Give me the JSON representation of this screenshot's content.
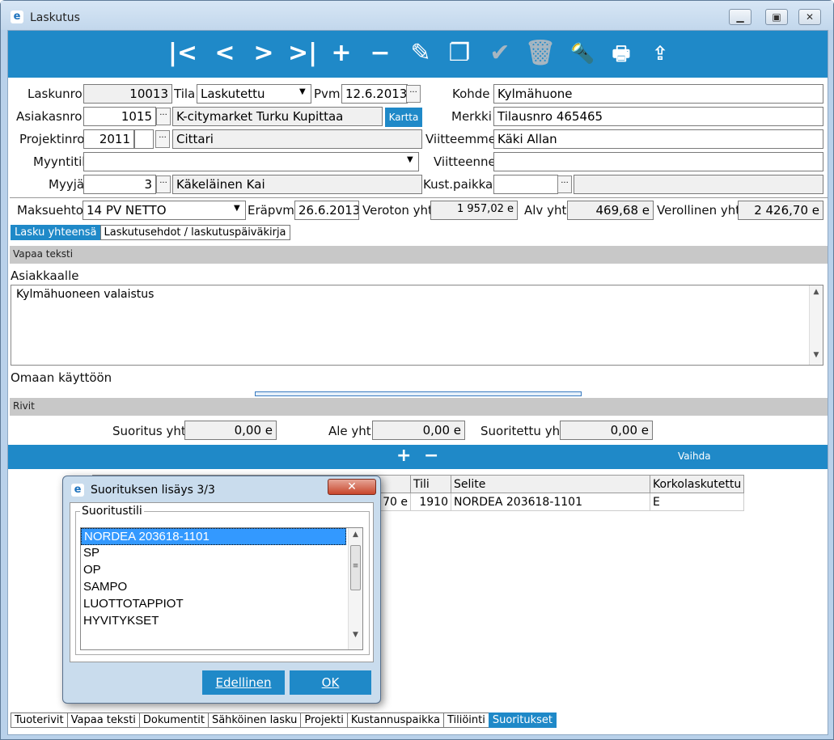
{
  "window": {
    "title": "Laskutus",
    "app_icon": "e"
  },
  "toolbar": {
    "icons": [
      "first-icon",
      "prev-icon",
      "next-icon",
      "last-icon",
      "add-icon",
      "remove-icon",
      "edit-icon",
      "copy-icon",
      "confirm-icon",
      "delete-icon",
      "search-icon",
      "print-icon",
      "export-icon"
    ]
  },
  "header": {
    "laskunro_label": "Laskunro",
    "laskunro": "10013",
    "tila_label": "Tila",
    "tila": "Laskutettu",
    "pvm_label": "Pvm",
    "pvm": "12.6.2013",
    "kohde_label": "Kohde",
    "kohde": "Kylmähuone",
    "asiakasnro_label": "Asiakasnro",
    "asiakasnro": "1015",
    "asiakas_nimi": "K-citymarket Turku Kupittaa",
    "kartta": "Kartta",
    "merkki_label": "Merkki",
    "merkki": "Tilausnro 465465",
    "projektinro_label": "Projektinro",
    "projektinro": "2011",
    "projekti_nimi": "Cittari",
    "viitteemme_label": "Viitteemme",
    "viitteemme": "Käki Allan",
    "myyntitili_label": "Myyntitili",
    "myyntitili": "",
    "viitteenne_label": "Viitteenne",
    "viitteenne": "",
    "myyja_label": "Myyjä",
    "myyja": "3",
    "myyja_nimi": "Käkeläinen Kai",
    "kustpaikka_label": "Kust.paikka",
    "kustpaikka": "",
    "maksuehto_label": "Maksuehto",
    "maksuehto": "14 PV NETTO",
    "erapvm_label": "Eräpvm",
    "erapvm": "26.6.2013",
    "veroton_label": "Veroton yht.",
    "veroton": "1 957,02 e",
    "alv_label": "Alv yht.",
    "alv": "469,68 e",
    "verollinen_label": "Verollinen yht.",
    "verollinen": "2 426,70 e"
  },
  "top_tabs": [
    "Lasku yhteensä",
    "Laskutusehdot / laskutuspäiväkirja"
  ],
  "vapaa": {
    "section": "Vapaa teksti",
    "asiakkaalle_label": "Asiakkaalle",
    "asiakkaalle_text": "Kylmähuoneen valaistus",
    "omaan_label": "Omaan käyttöön"
  },
  "rivit": {
    "section": "Rivit",
    "suoritus_label": "Suoritus yht.",
    "suoritus": "0,00 e",
    "ale_label": "Ale yht.",
    "ale": "0,00 e",
    "suoritettu_label": "Suoritettu yht.",
    "suoritettu": "0,00 e",
    "add": "+",
    "remove": "−",
    "vaihda": "Vaihda"
  },
  "grid": {
    "headers": [
      "Tili",
      "Selite",
      "Korkolaskutettu"
    ],
    "row": {
      "amount_tail": "70 e",
      "tili": "1910",
      "selite": "NORDEA 203618-1101",
      "korko": "E"
    }
  },
  "bottom_tabs": [
    "Tuoterivit",
    "Vapaa teksti",
    "Dokumentit",
    "Sähköinen lasku",
    "Projekti",
    "Kustannuspaikka",
    "Tiliöinti",
    "Suoritukset"
  ],
  "dialog": {
    "title": "Suorituksen lisäys 3/3",
    "group_label": "Suoritustili",
    "items": [
      "NORDEA 203618-1101",
      "SP",
      "OP",
      "SAMPO",
      "LUOTTOTAPPIOT",
      "HYVITYKSET"
    ],
    "selected": 0,
    "prev_button": "Edellinen",
    "ok_button": "OK",
    "close": "✕"
  },
  "colors": {
    "accent": "#1f89c8",
    "selection": "#3399ff"
  }
}
